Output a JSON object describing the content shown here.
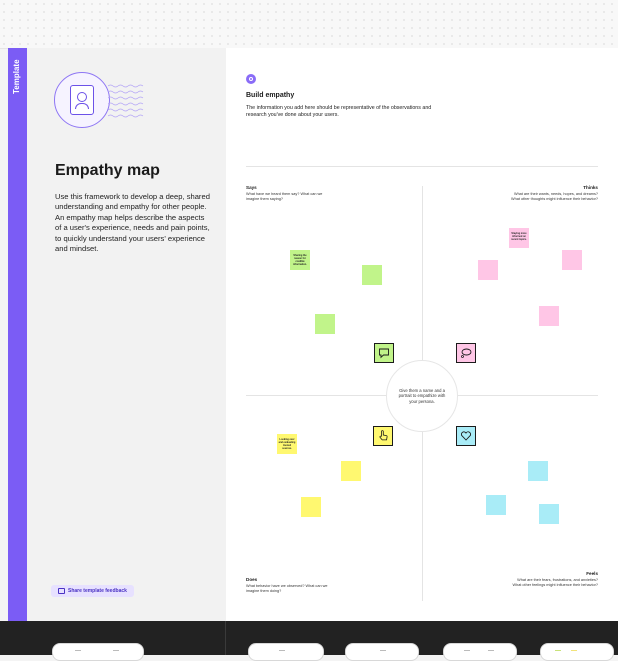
{
  "template_tab": {
    "label": "Template"
  },
  "left_panel": {
    "title": "Empathy map",
    "description": "Use this framework to develop a deep, shared understanding and empathy for other people. An empathy map helps describe the aspects of a user's experience, needs and pain points, to quickly understand your users' experience and mindset.",
    "feedback_label": "Share template feedback"
  },
  "canvas": {
    "step_title": "Build empathy",
    "step_description": "The information you add here should be representative of the observations and research you've done about your users.",
    "center_text": "Give them a name and a portrait to empathize with your persona.",
    "quadrants": {
      "says": {
        "label": "Says",
        "prompt": "What have we heard them say? What can we imagine them saying?"
      },
      "thinks": {
        "label": "Thinks",
        "prompt": "What are their wants, needs, hopes, and dreams? What other thoughts might influence their behavior?"
      },
      "does": {
        "label": "Does",
        "prompt": "What behavior have we observed? What can we imagine them doing?"
      },
      "feels": {
        "label": "Feels",
        "prompt": "What are their fears, frustrations, and anxieties? What other feelings might influence their behavior?"
      }
    },
    "notes": {
      "says_note": "Sharing the reason for credible information.",
      "thinks_note": "Staying more informed on recent topics.",
      "does_note": "Looking over and evaluating trusted sources."
    }
  },
  "colors": {
    "accent": "#7b5cf5",
    "green_note": "#c1f48a",
    "pink_note": "#ffc6e6",
    "yellow_note": "#fff870",
    "cyan_note": "#a9ecf7"
  },
  "icons": [
    "person-portrait-icon",
    "speech-bubble-icon",
    "thought-bubble-icon",
    "pointing-hand-icon",
    "heart-icon",
    "feedback-icon",
    "step-icon"
  ]
}
